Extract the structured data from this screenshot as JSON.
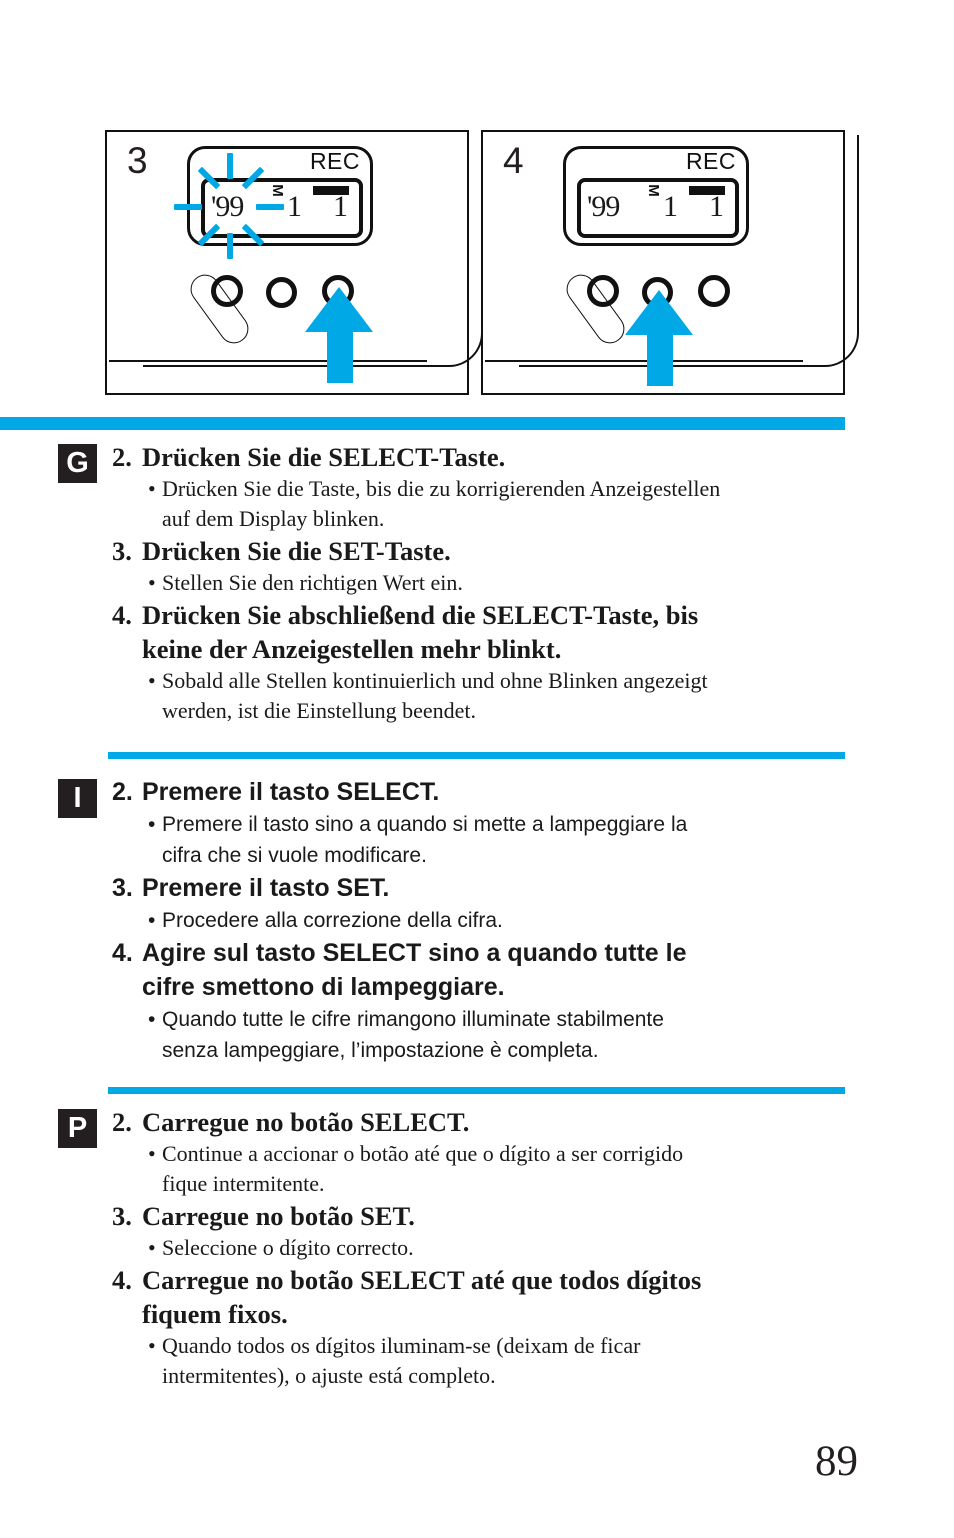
{
  "page": {
    "number": "89"
  },
  "accent_color": "#00A9E6",
  "illustrations": [
    {
      "step_number": "3",
      "display": {
        "rec_label": "REC",
        "year": "'99",
        "month": "1",
        "day": "1",
        "month_marker": "M",
        "blinking": true,
        "blink_target": "year"
      },
      "arrow_points_to": "select-button"
    },
    {
      "step_number": "4",
      "display": {
        "rec_label": "REC",
        "year": "'99",
        "month": "1",
        "day": "1",
        "month_marker": "M",
        "blinking": false,
        "blink_target": ""
      },
      "arrow_points_to": "set-button"
    }
  ],
  "sections": [
    {
      "badge": "G",
      "language": "german",
      "steps": [
        {
          "number": "2.",
          "heading": "Drücken Sie die SELECT-Taste.",
          "heading_cont": "",
          "bullets": [
            {
              "line1": "Drücken Sie die Taste, bis die zu korrigierenden Anzeigestellen",
              "line2": "auf dem Display blinken."
            }
          ]
        },
        {
          "number": "3.",
          "heading": "Drücken Sie die SET-Taste.",
          "heading_cont": "",
          "bullets": [
            {
              "line1": "Stellen Sie den richtigen Wert ein.",
              "line2": ""
            }
          ]
        },
        {
          "number": "4.",
          "heading": "Drücken Sie abschließend die SELECT-Taste, bis",
          "heading_cont": "keine der Anzeigestellen mehr blinkt.",
          "bullets": [
            {
              "line1": "Sobald alle Stellen kontinuierlich und ohne Blinken angezeigt",
              "line2": "werden, ist die Einstellung beendet."
            }
          ]
        }
      ]
    },
    {
      "badge": "I",
      "language": "italian",
      "steps": [
        {
          "number": "2.",
          "heading": "Premere il tasto SELECT.",
          "heading_cont": "",
          "bullets": [
            {
              "line1": "Premere il tasto sino a quando si mette a lampeggiare la",
              "line2": "cifra che si vuole modificare."
            }
          ]
        },
        {
          "number": "3.",
          "heading": "Premere il tasto SET.",
          "heading_cont": "",
          "bullets": [
            {
              "line1": "Procedere alla correzione della cifra.",
              "line2": ""
            }
          ]
        },
        {
          "number": "4.",
          "heading": "Agire sul tasto SELECT sino a quando tutte le",
          "heading_cont": "cifre smettono di lampeggiare.",
          "bullets": [
            {
              "line1": "Quando tutte le cifre rimangono illuminate stabilmente",
              "line2": "senza lampeggiare, l’impostazione è completa."
            }
          ]
        }
      ]
    },
    {
      "badge": "P",
      "language": "portuguese",
      "steps": [
        {
          "number": "2.",
          "heading": "Carregue no botão SELECT.",
          "heading_cont": "",
          "bullets": [
            {
              "line1": "Continue a accionar o botão até que o dígito a ser corrigido",
              "line2": "fique intermitente."
            }
          ]
        },
        {
          "number": "3.",
          "heading": "Carregue no botão SET.",
          "heading_cont": "",
          "bullets": [
            {
              "line1": "Seleccione o dígito correcto.",
              "line2": ""
            }
          ]
        },
        {
          "number": "4.",
          "heading": "Carregue no botão SELECT até que todos dígitos",
          "heading_cont": "fiquem fixos.",
          "bullets": [
            {
              "line1": "Quando todos os dígitos iluminam-se (deixam de ficar",
              "line2": "intermitentes), o ajuste está completo."
            }
          ]
        }
      ]
    }
  ],
  "bullet_glyph": "•"
}
